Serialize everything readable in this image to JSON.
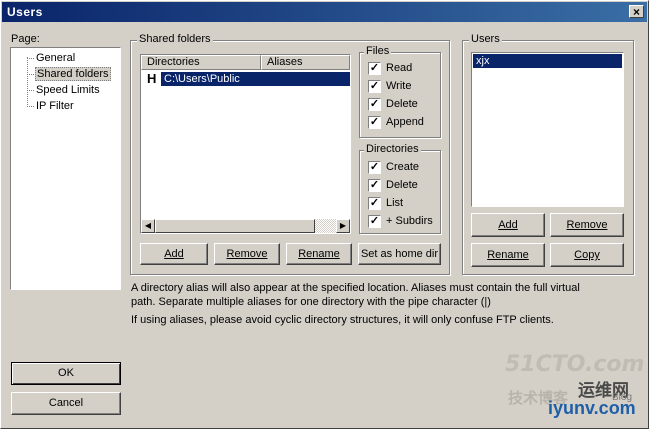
{
  "window": {
    "title": "Users",
    "close_glyph": "×"
  },
  "page_panel": {
    "label": "Page:",
    "items": [
      "General",
      "Shared folders",
      "Speed Limits",
      "IP Filter"
    ],
    "selected": "Shared folders"
  },
  "shared_folders": {
    "group_label": "Shared folders",
    "columns": [
      "Directories",
      "Aliases"
    ],
    "rows": [
      {
        "flag": "H",
        "directory": "C:\\Users\\Public",
        "alias": ""
      }
    ],
    "buttons": {
      "add": "Add",
      "remove": "Remove",
      "rename": "Rename",
      "set_home": "Set as home dir"
    }
  },
  "files": {
    "group_label": "Files",
    "options": [
      {
        "label": "Read",
        "checked": true
      },
      {
        "label": "Write",
        "checked": true
      },
      {
        "label": "Delete",
        "checked": true
      },
      {
        "label": "Append",
        "checked": true
      }
    ]
  },
  "directories": {
    "group_label": "Directories",
    "options": [
      {
        "label": "Create",
        "checked": true
      },
      {
        "label": "Delete",
        "checked": true
      },
      {
        "label": "List",
        "checked": true
      },
      {
        "label": "+ Subdirs",
        "checked": true
      }
    ]
  },
  "users": {
    "group_label": "Users",
    "list": [
      "xjx"
    ],
    "selected": "xjx",
    "buttons": {
      "add": "Add",
      "remove": "Remove",
      "rename": "Rename",
      "copy": "Copy"
    }
  },
  "notes": {
    "line1": "A directory alias will also appear at the specified location. Aliases must contain the full virtual",
    "line2": "path. Separate multiple aliases for one directory with the pipe character (|)",
    "line3": "If using aliases, please avoid cyclic directory structures, it will only confuse FTP clients."
  },
  "dialog_buttons": {
    "ok": "OK",
    "cancel": "Cancel"
  },
  "watermark": {
    "text1": "51CTO.com",
    "text2": "技术博客",
    "text3": "运维网",
    "text4": "iyunv.com",
    "text5": "Blog"
  },
  "check_glyph": "✓",
  "icons": [
    "close-icon",
    "check-icon",
    "scroll-left-icon",
    "scroll-right-icon"
  ]
}
